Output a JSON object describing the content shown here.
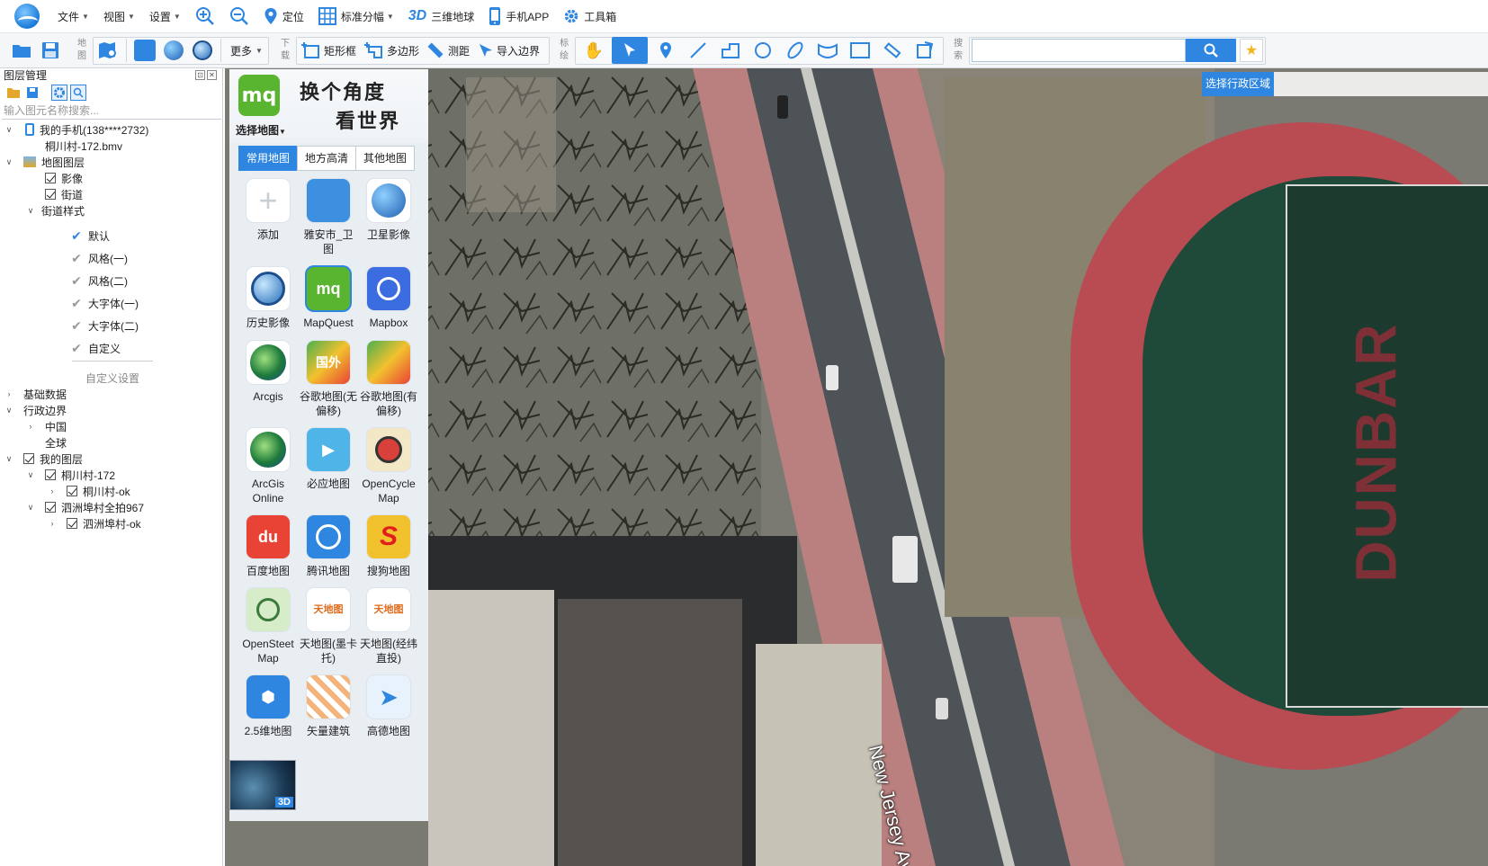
{
  "menu": {
    "file": "文件",
    "view": "视图",
    "settings": "设置",
    "locate": "定位",
    "std_sheet": "标准分幅",
    "globe_3d_tag": "3D",
    "globe_3d": "三维地球",
    "mobile_app": "手机APP",
    "toolbox": "工具箱"
  },
  "toolbar": {
    "map_group_label": "地图",
    "more": "更多",
    "download_label": "下载",
    "rect": "矩形框",
    "polygon": "多边形",
    "measure": "测距",
    "import_boundary": "导入边界",
    "mark_label": "标绘",
    "search_label": "搜索",
    "search_value": ""
  },
  "layer_panel": {
    "title": "图层管理",
    "search_placeholder": "输入图元名称搜索...",
    "tree": {
      "my_phone": "我的手机(138****2732)",
      "phone_file": "桐川村-172.bmv",
      "map_layers": "地图图层",
      "imagery": "影像",
      "street": "街道",
      "street_style": "街道样式",
      "styles": [
        "默认",
        "风格(一)",
        "风格(二)",
        "大字体(一)",
        "大字体(二)",
        "自定义"
      ],
      "custom_settings": "自定义设置",
      "base_data": "基础数据",
      "admin_boundary": "行政边界",
      "china": "中国",
      "world": "全球",
      "my_layers": "我的图层",
      "layer1": "桐川村-172",
      "layer1_child": "桐川村-ok",
      "layer2": "泗洲埠村全拍967",
      "layer2_child": "泗洲埠村-ok"
    }
  },
  "map_picker": {
    "logo": "mq",
    "select_map": "选择地图",
    "slogan_line1": "换个角度",
    "slogan_line2": "看世界",
    "tabs": [
      "常用地图",
      "地方高清",
      "其他地图"
    ],
    "items": [
      {
        "label": "添加",
        "icon": "plus-icon"
      },
      {
        "label": "雅安市_卫图",
        "icon": "package-icon"
      },
      {
        "label": "卫星影像",
        "icon": "google-earth-icon"
      },
      {
        "label": "历史影像",
        "icon": "history-earth-icon"
      },
      {
        "label": "MapQuest",
        "icon": "mapquest-icon"
      },
      {
        "label": "Mapbox",
        "icon": "mapbox-icon"
      },
      {
        "label": "Arcgis",
        "icon": "arcgis-icon"
      },
      {
        "label": "谷歌地图(无偏移)",
        "icon": "google-maps-intl-icon",
        "icon_text": "国外"
      },
      {
        "label": "谷歌地图(有偏移)",
        "icon": "google-maps-icon"
      },
      {
        "label": "ArcGis Online",
        "icon": "arcgis-online-icon"
      },
      {
        "label": "必应地图",
        "icon": "bing-maps-icon"
      },
      {
        "label": "OpenCycle Map",
        "icon": "opencycle-icon"
      },
      {
        "label": "百度地图",
        "icon": "baidu-icon",
        "icon_text": "du"
      },
      {
        "label": "腾讯地图",
        "icon": "tencent-maps-icon"
      },
      {
        "label": "搜狗地图",
        "icon": "sogou-icon",
        "icon_text": "S"
      },
      {
        "label": "OpenSteet Map",
        "icon": "openstreetmap-icon"
      },
      {
        "label": "天地图(墨卡托)",
        "icon": "tianditu-icon",
        "icon_text": "天地图"
      },
      {
        "label": "天地图(经纬直投)",
        "icon": "tianditu-icon",
        "icon_text": "天地图"
      },
      {
        "label": "2.5维地图",
        "icon": "map-25d-icon"
      },
      {
        "label": "矢量建筑",
        "icon": "vector-building-icon"
      },
      {
        "label": "高德地图",
        "icon": "amap-icon"
      }
    ],
    "globe_3d_badge": "3D"
  },
  "map": {
    "region_button": "选择行政区域",
    "street_label": "New Jersey Ave N",
    "stadium_text": "DUNBAR"
  },
  "colors": {
    "accent": "#2f86e0",
    "track": "#b94b53",
    "field": "#1f4a3a"
  }
}
